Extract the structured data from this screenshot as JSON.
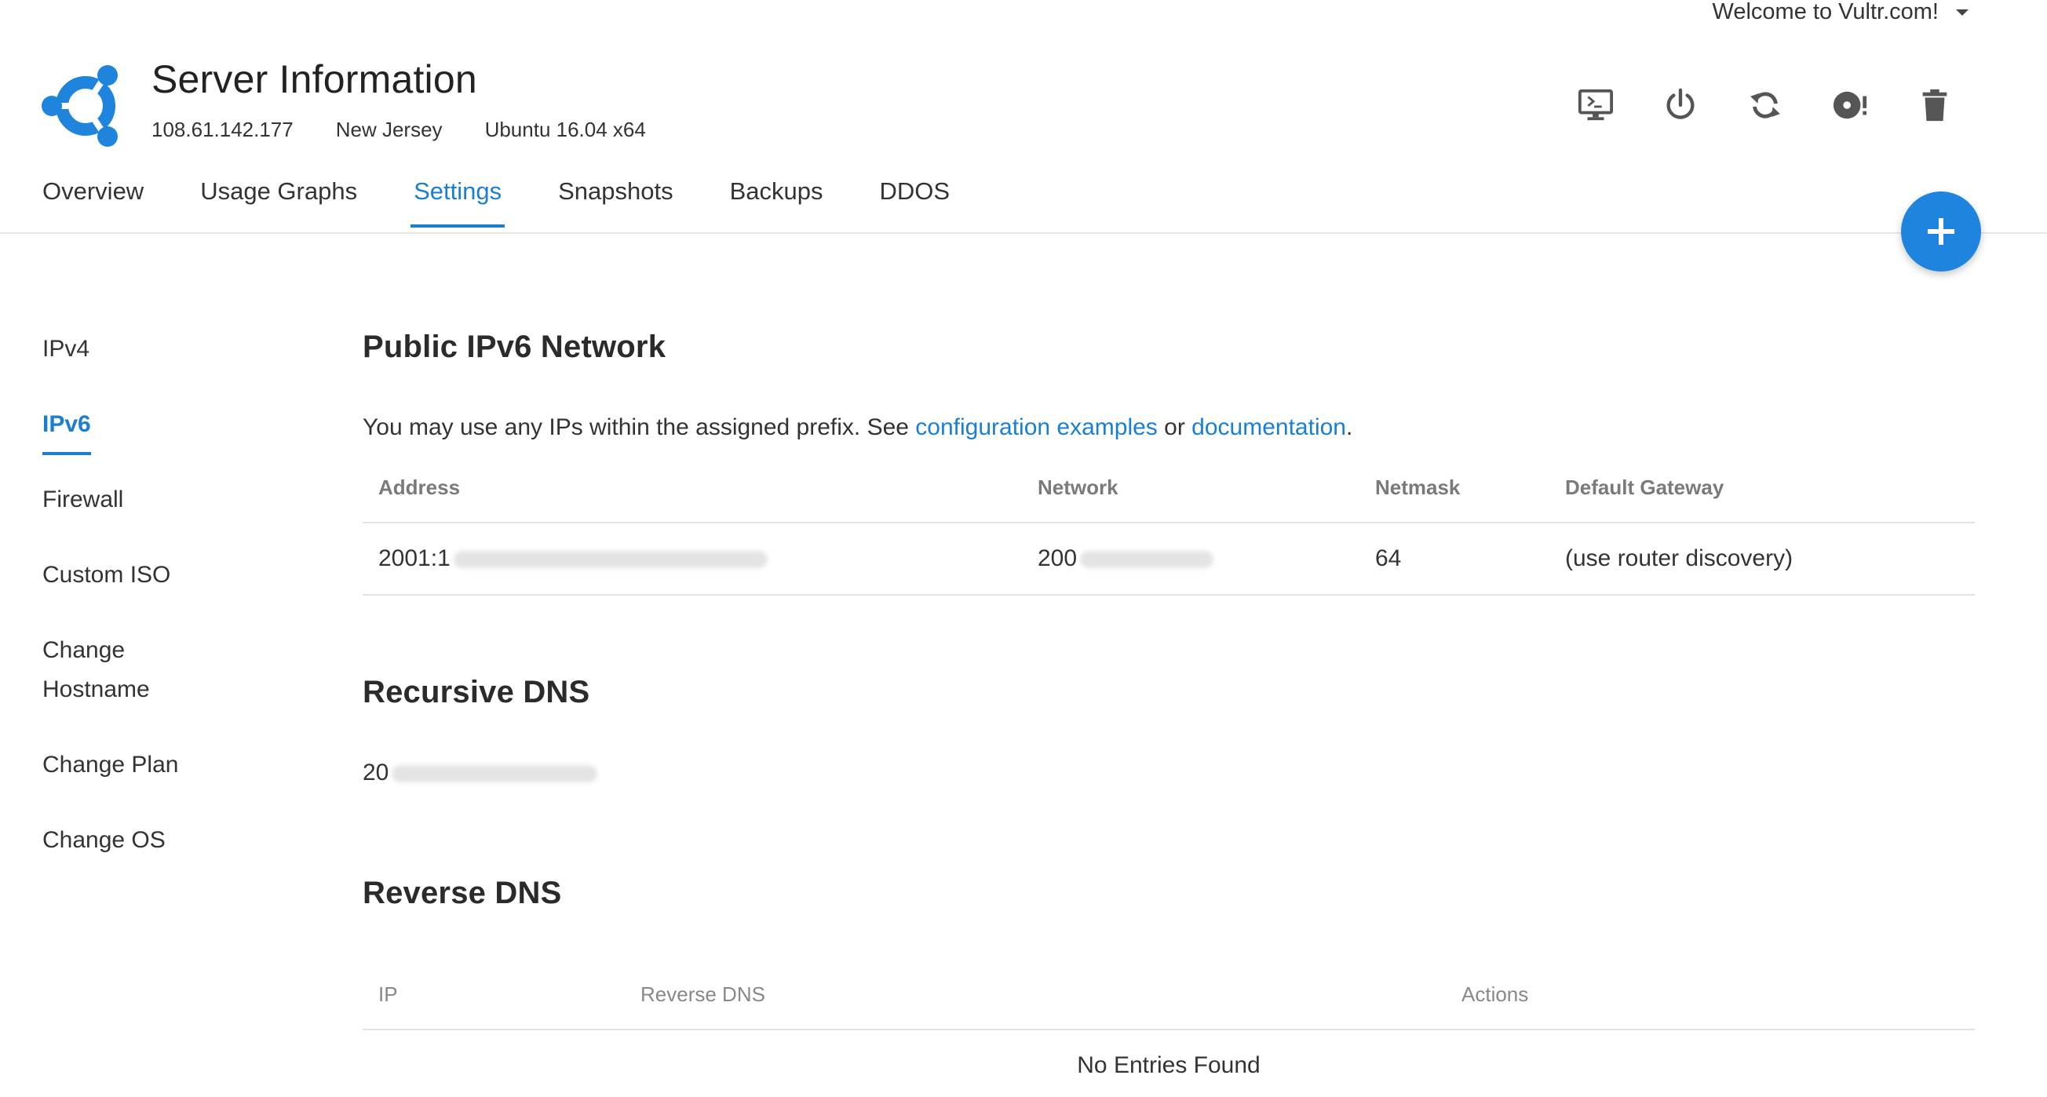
{
  "header": {
    "welcome": "Welcome to Vultr.com!",
    "title": "Server Information",
    "ip": "108.61.142.177",
    "location": "New Jersey",
    "os": "Ubuntu 16.04 x64",
    "logo_icon": "ubuntu-logo-icon",
    "accent_color": "#1b7fd1",
    "actions": [
      {
        "name": "view-console-button",
        "icon": "monitor-console-icon"
      },
      {
        "name": "server-stop-button",
        "icon": "power-icon"
      },
      {
        "name": "server-restart-button",
        "icon": "refresh-icon"
      },
      {
        "name": "server-reinstall-button",
        "icon": "disc-alert-icon"
      },
      {
        "name": "server-destroy-button",
        "icon": "trash-icon"
      }
    ]
  },
  "tabs": [
    {
      "label": "Overview",
      "active": false
    },
    {
      "label": "Usage Graphs",
      "active": false
    },
    {
      "label": "Settings",
      "active": true
    },
    {
      "label": "Snapshots",
      "active": false
    },
    {
      "label": "Backups",
      "active": false
    },
    {
      "label": "DDOS",
      "active": false
    }
  ],
  "sidenav": [
    {
      "label": "IPv4",
      "active": false
    },
    {
      "label": "IPv6",
      "active": true
    },
    {
      "label": "Firewall",
      "active": false
    },
    {
      "label": "Custom ISO",
      "active": false
    },
    {
      "label": "Change\nHostname",
      "active": false
    },
    {
      "label": "Change Plan",
      "active": false
    },
    {
      "label": "Change OS",
      "active": false
    }
  ],
  "ipv6": {
    "heading": "Public IPv6 Network",
    "desc_prefix": "You may use any IPs within the assigned prefix. See ",
    "link1": "configuration examples",
    "desc_mid": " or ",
    "link2": "documentation",
    "desc_suffix": ".",
    "columns": [
      "Address",
      "Network",
      "Netmask",
      "Default Gateway"
    ],
    "row": {
      "address": "2001:1",
      "network": "200",
      "netmask": "64",
      "gateway": "(use router discovery)"
    }
  },
  "recursive_dns": {
    "heading": "Recursive DNS",
    "value": "20"
  },
  "reverse_dns": {
    "heading": "Reverse DNS",
    "columns": [
      "IP",
      "Reverse DNS",
      "Actions"
    ],
    "empty": "No Entries Found"
  }
}
